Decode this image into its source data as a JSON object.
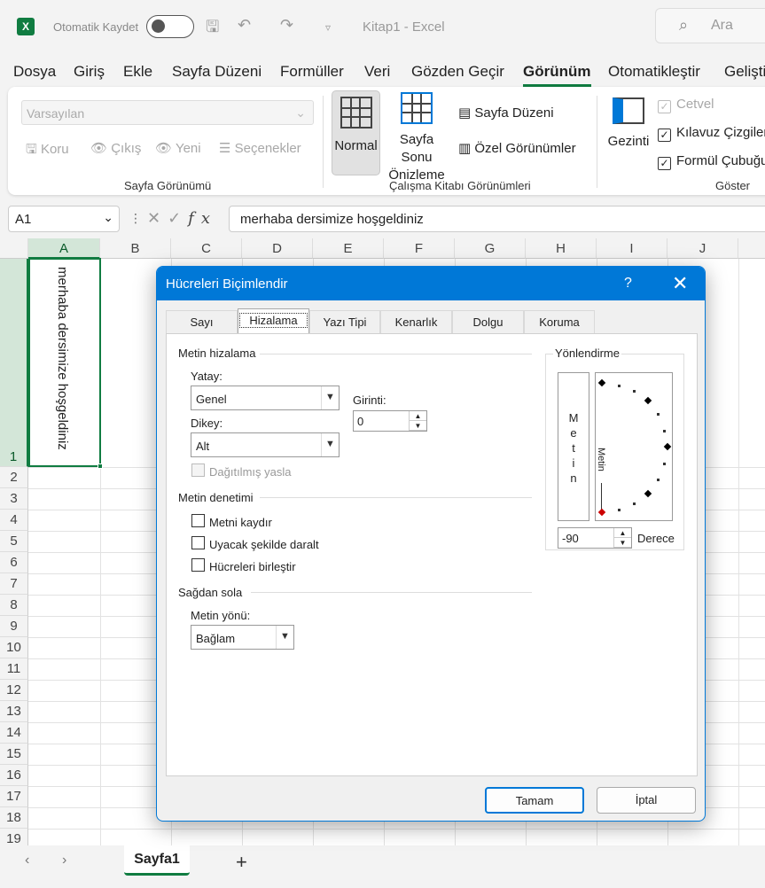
{
  "titlebar": {
    "autosave_label": "Otomatik Kaydet",
    "doc_title": "Kitap1  -  Excel",
    "search_placeholder": "Ara"
  },
  "menu": [
    "Dosya",
    "Giriş",
    "Ekle",
    "Sayfa Düzeni",
    "Formüller",
    "Veri",
    "Gözden Geçir",
    "Görünüm",
    "Otomatikleştir",
    "Geliştir"
  ],
  "ribbon": {
    "sheet_view": {
      "select_value": "Varsayılan",
      "keep": "Koru",
      "exit": "Çıkış",
      "new": "Yeni",
      "options": "Seçenekler",
      "group_label": "Sayfa Görünümü"
    },
    "workbook_views": {
      "normal": "Normal",
      "page_break_1": "Sayfa Sonu",
      "page_break_2": "Önizleme",
      "page_layout": "Sayfa Düzeni",
      "custom_views": "Özel Görünümler",
      "group_label": "Çalışma Kitabı Görünümleri"
    },
    "navigate": {
      "label": "Gezinti"
    },
    "show": {
      "ruler": "Cetvel",
      "gridlines": "Kılavuz Çizgiler",
      "formula_bar": "Formül Çubuğu",
      "group_label": "Göster"
    }
  },
  "formula_bar": {
    "cell_ref": "A1",
    "content": "merhaba dersimize hoşgeldiniz"
  },
  "sheet": {
    "columns": [
      "A",
      "B",
      "C",
      "D",
      "E",
      "F",
      "G",
      "H",
      "I",
      "J"
    ],
    "rows": [
      "1",
      "2",
      "3",
      "4",
      "5",
      "6",
      "7",
      "8",
      "9",
      "10",
      "11",
      "12",
      "13",
      "14",
      "15",
      "16",
      "17",
      "18",
      "19"
    ],
    "a1_text": "merhaba dersimize hoşgeldiniz",
    "tab_name": "Sayfa1"
  },
  "dialog": {
    "title": "Hücreleri Biçimlendir",
    "tabs": [
      "Sayı",
      "Hizalama",
      "Yazı Tipi",
      "Kenarlık",
      "Dolgu",
      "Koruma"
    ],
    "text_alignment": "Metin hizalama",
    "horizontal_label": "Yatay:",
    "horizontal_value": "Genel",
    "indent_label": "Girinti:",
    "indent_value": "0",
    "vertical_label": "Dikey:",
    "vertical_value": "Alt",
    "justify_distributed": "Dağıtılmış yasla",
    "text_control": "Metin denetimi",
    "wrap_text": "Metni kaydır",
    "shrink_to_fit": "Uyacak şekilde daralt",
    "merge_cells": "Hücreleri birleştir",
    "rtl": "Sağdan sola",
    "text_direction_label": "Metin yönü:",
    "text_direction_value": "Bağlam",
    "orientation": "Yönlendirme",
    "vertical_text": [
      "M",
      "e",
      "t",
      "i",
      "n"
    ],
    "dial_text": "Metin",
    "degrees_value": "-90",
    "degrees_label": "Derece",
    "ok": "Tamam",
    "cancel": "İptal"
  }
}
